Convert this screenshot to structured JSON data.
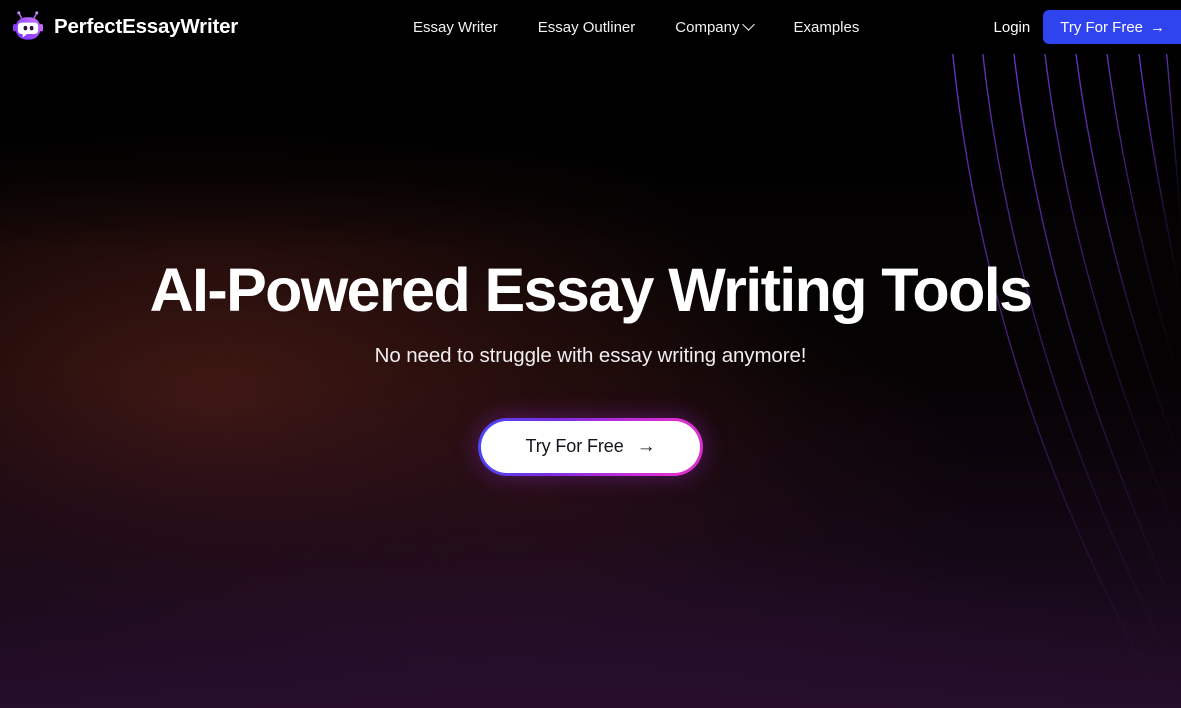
{
  "brand": {
    "name": "PerfectEssayWriter",
    "logo_icon": "robot-bot-head-icon"
  },
  "nav": {
    "items": [
      {
        "label": "Essay Writer",
        "has_dropdown": false
      },
      {
        "label": "Essay Outliner",
        "has_dropdown": false
      },
      {
        "label": "Company",
        "has_dropdown": true
      },
      {
        "label": "Examples",
        "has_dropdown": false
      }
    ],
    "login_label": "Login",
    "cta_label": "Try For Free",
    "cta_arrow": "→",
    "cta_color": "#2f44ef"
  },
  "hero": {
    "title": "AI-Powered Essay Writing Tools",
    "subtitle": "No need to struggle with essay writing anymore!",
    "cta_label": "Try For Free",
    "cta_arrow": "→",
    "cta_background": "#ffffff",
    "cta_text_color": "#15151d",
    "cta_border_gradient_start": "#4a46f5",
    "cta_border_gradient_mid": "#b82ddc",
    "cta_border_gradient_end": "#e02fd0"
  },
  "theme": {
    "page_background": "#000000",
    "accent_purple": "#7b2ee0",
    "accent_magenta": "#e02fd0",
    "accent_blue": "#2f44ef",
    "warm_glow": "#3a1410",
    "bottom_purple": "#260e2c"
  }
}
